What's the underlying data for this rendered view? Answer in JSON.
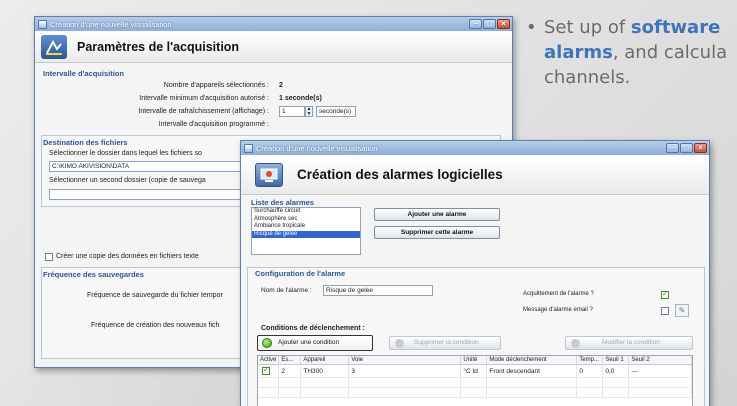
{
  "bullet": {
    "line1_plain": "Set up of ",
    "line1_bold": "software",
    "line2_bold": "alarms",
    "line2_plain": ", and calcula",
    "line3_plain": "channels."
  },
  "window1": {
    "title": "Création d'une nouvelle visualisation",
    "header": "Paramètres de l'acquisition",
    "acq_section": "Intervalle d'acquisition",
    "nb_devices_label": "Nombre d'appareils sélectionnés :",
    "nb_devices_value": "2",
    "min_interval_label": "Intervalle minimum d'acquisition autorisé :",
    "min_interval_value": "1 seconde(s)",
    "refresh_label": "Intervalle de rafraîchissement (affichage) :",
    "refresh_value": "1",
    "refresh_unit": "seconde(s)",
    "programmed_label": "Intervalle d'acquisition programmé :",
    "files_section": "Destination des fichiers",
    "folder_label": "Sélectionner le dossier dans lequel les fichiers so",
    "folder_value": "C:\\KIMO AKIVISION\\DATA",
    "second_folder_label": "Sélectionner un second dossier (copie de sauvega",
    "second_folder_value": "",
    "copy_text_label": "Créer une copie des données en fichiers texte",
    "save_section": "Fréquence des sauvegardes",
    "temp_save_label": "Fréquence de sauvegarde du fichier tempor",
    "new_files_label": "Fréquence de création des nouveaux fich"
  },
  "window2": {
    "title": "Création d'une nouvelle visualisation",
    "header": "Création des alarmes logicielles",
    "list_section": "Liste des alarmes",
    "alarms": [
      "Surchauffe circuit",
      "Atmosphère sec",
      "Ambiance tropicale",
      "Risque de gelée"
    ],
    "selected_alarm_index": 3,
    "add_alarm": "Ajouter une alarme",
    "delete_alarm": "Supprimer cette alarme",
    "config_section": "Configuration de l'alarme",
    "name_label": "Nom de l'alarme :",
    "name_value": "Risque de gelée",
    "ack_label": "Acquittement de l'alarme ?",
    "email_label": "Message d'alarme email ?",
    "trigger_section": "Conditions de déclenchement :",
    "add_condition": "Ajouter une condition",
    "delete_condition": "Supprimer la condition",
    "edit_condition": "Modifier la condition",
    "columns": [
      "Active",
      "Es...",
      "Appareil",
      "Voie",
      "Unité",
      "Mode déclenchement",
      "Temp...",
      "Seuil 1",
      "Seuil 2"
    ],
    "rows": [
      {
        "es": "2",
        "device": "TH300",
        "channel": "3",
        "unit": "°C td",
        "mode": "Front descendant",
        "temp": "0",
        "s1": "0,0",
        "s2": "---"
      }
    ]
  }
}
